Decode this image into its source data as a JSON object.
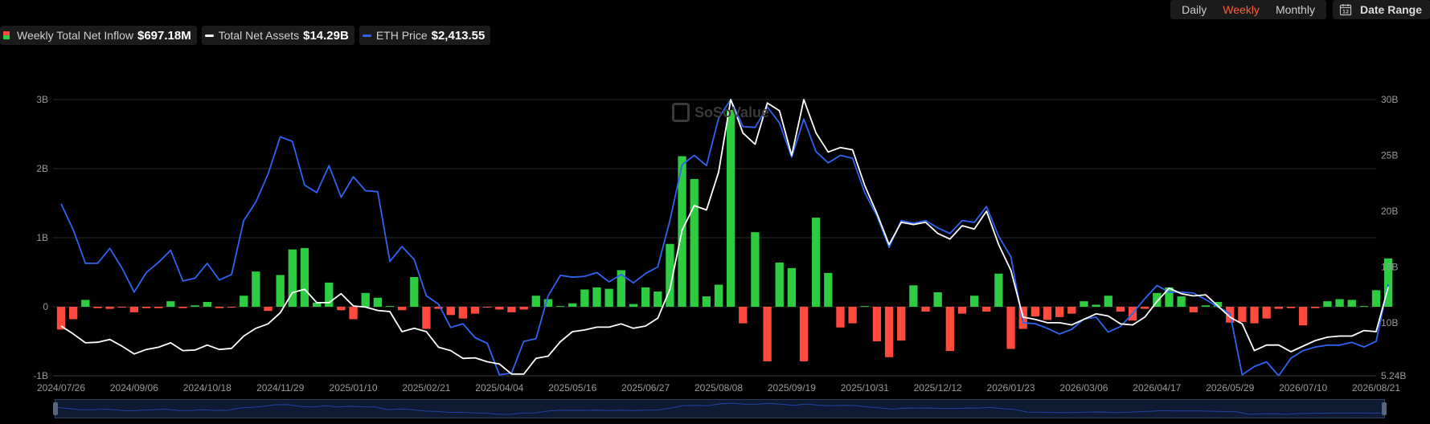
{
  "controls": {
    "periods": [
      "Daily",
      "Weekly",
      "Monthly"
    ],
    "active_period": "Weekly",
    "date_range_label": "Date Range"
  },
  "legend": {
    "inflow_label": "Weekly Total Net Inflow",
    "inflow_value": "$697.18M",
    "assets_label": "Total Net Assets",
    "assets_value": "$14.29B",
    "price_label": "ETH Price",
    "price_value": "$2,413.55"
  },
  "watermark": "SoSoValue",
  "colors": {
    "positive": "#2ecc40",
    "negative": "#ff4a3d",
    "assets_line": "#ffffff",
    "price_line": "#2f63f0",
    "active_period": "#ff5b3a"
  },
  "chart_data": {
    "type": "bar",
    "x": [
      "2024/07/26",
      "2024/08/02",
      "2024/08/09",
      "2024/08/16",
      "2024/08/23",
      "2024/08/30",
      "2024/09/06",
      "2024/09/13",
      "2024/09/20",
      "2024/09/27",
      "2024/10/04",
      "2024/10/11",
      "2024/10/18",
      "2024/10/25",
      "2024/11/01",
      "2024/11/08",
      "2024/11/15",
      "2024/11/22",
      "2024/11/29",
      "2024/12/06",
      "2024/12/13",
      "2024/12/20",
      "2024/12/27",
      "2025/01/03",
      "2025/01/10",
      "2025/01/17",
      "2025/01/24",
      "2025/01/31",
      "2025/02/07",
      "2025/02/14",
      "2025/02/21",
      "2025/02/28",
      "2025/03/07",
      "2025/03/14",
      "2025/03/21",
      "2025/03/28",
      "2025/04/04",
      "2025/04/11",
      "2025/04/18",
      "2025/04/25",
      "2025/05/02",
      "2025/05/09",
      "2025/05/16",
      "2025/05/23",
      "2025/05/30",
      "2025/06/06",
      "2025/06/13",
      "2025/06/20",
      "2025/06/27",
      "2025/07/04",
      "2025/07/11",
      "2025/07/18",
      "2025/07/25",
      "2025/08/01",
      "2025/08/08",
      "2025/08/15",
      "2025/08/22",
      "2025/08/29",
      "2025/09/05",
      "2025/09/12",
      "2025/09/19",
      "2025/09/26",
      "2025/10/03",
      "2025/10/10",
      "2025/10/17",
      "2025/10/24",
      "2025/10/31",
      "2025/11/07",
      "2025/11/14",
      "2025/11/21",
      "2025/11/28",
      "2025/12/05",
      "2025/12/12",
      "2025/12/19",
      "2025/12/26",
      "2026/01/02",
      "2026/01/09",
      "2026/01/16",
      "2026/01/23",
      "2026/01/30",
      "2026/02/06",
      "2026/02/13",
      "2026/02/20",
      "2026/02/27",
      "2026/03/06",
      "2026/03/13",
      "2026/03/20",
      "2026/03/27",
      "2026/04/03",
      "2026/04/10",
      "2026/04/17",
      "2026/04/24",
      "2026/05/01",
      "2026/05/08",
      "2026/05/15",
      "2026/05/22",
      "2026/05/29",
      "2026/06/05",
      "2026/06/12",
      "2026/06/19",
      "2026/06/26",
      "2026/07/03",
      "2026/07/10",
      "2026/07/17",
      "2026/07/24",
      "2026/07/31",
      "2026/08/07",
      "2026/08/14",
      "2026/08/21"
    ],
    "x_tick_labels": [
      "2024/07/26",
      "2024/09/06",
      "2024/10/18",
      "2024/11/29",
      "2025/01/10",
      "2025/02/21",
      "2025/04/04",
      "2025/05/16",
      "2025/06/27",
      "2025/08/08",
      "2025/09/19",
      "2025/10/31",
      "2025/12/12",
      "2026/01/23",
      "2026/03/06",
      "2026/04/17",
      "2026/05/29",
      "2026/07/10",
      "2026/08/21"
    ],
    "series": [
      {
        "name": "Weekly Total Net Inflow",
        "unit": "B",
        "axis": "left",
        "values": [
          -0.33,
          -0.18,
          0.1,
          -0.02,
          -0.03,
          -0.01,
          -0.08,
          -0.02,
          -0.02,
          0.08,
          -0.02,
          0.02,
          0.07,
          -0.02,
          -0.01,
          0.16,
          0.51,
          -0.06,
          0.46,
          0.83,
          0.85,
          0.06,
          0.35,
          -0.05,
          -0.18,
          0.2,
          0.13,
          0.01,
          -0.05,
          0.43,
          -0.32,
          -0.03,
          -0.12,
          -0.17,
          -0.1,
          -0.01,
          -0.04,
          -0.08,
          -0.04,
          0.16,
          0.11,
          0.01,
          0.05,
          0.25,
          0.28,
          0.26,
          0.53,
          0.04,
          0.28,
          0.22,
          0.91,
          2.18,
          1.85,
          0.15,
          0.32,
          2.85,
          -0.24,
          1.08,
          -0.79,
          0.64,
          0.56,
          -0.79,
          1.29,
          0.49,
          -0.3,
          -0.24,
          0.01,
          -0.5,
          -0.73,
          -0.49,
          0.31,
          -0.07,
          0.21,
          -0.64,
          -0.1,
          0.16,
          -0.07,
          0.48,
          -0.61,
          -0.32,
          -0.14,
          -0.19,
          -0.15,
          -0.1,
          0.08,
          0.03,
          0.16,
          -0.07,
          -0.2,
          -0.03,
          0.2,
          0.28,
          0.15,
          -0.08,
          0.02,
          0.07,
          -0.23,
          -0.22,
          -0.24,
          -0.17,
          -0.03,
          -0.02,
          -0.27,
          -0.02,
          0.08,
          0.11,
          0.1,
          0.01,
          0.24,
          0.7
        ]
      },
      {
        "name": "Total Net Assets",
        "unit": "B",
        "axis": "right",
        "values": [
          9.7,
          9.0,
          8.2,
          8.25,
          8.5,
          7.9,
          7.2,
          7.6,
          7.8,
          8.2,
          7.5,
          7.55,
          8.0,
          7.6,
          7.7,
          8.8,
          9.5,
          9.9,
          10.9,
          12.7,
          13.0,
          11.8,
          11.8,
          12.6,
          11.5,
          11.4,
          11.1,
          11.0,
          9.2,
          9.5,
          9.2,
          7.8,
          7.5,
          6.8,
          6.85,
          6.5,
          6.3,
          5.4,
          5.4,
          6.8,
          7.0,
          8.3,
          9.2,
          9.35,
          9.6,
          9.6,
          9.9,
          9.5,
          9.7,
          10.4,
          13.0,
          18.3,
          20.5,
          20.1,
          23.5,
          30.0,
          27.0,
          26.0,
          29.7,
          29.0,
          25.0,
          30.0,
          27.0,
          25.3,
          25.7,
          25.5,
          22.3,
          19.8,
          17.0,
          19.0,
          18.8,
          19.0,
          18.0,
          17.5,
          18.7,
          18.4,
          20.0,
          17.0,
          14.7,
          10.5,
          10.3,
          10.0,
          10.0,
          9.8,
          10.3,
          10.8,
          10.6,
          9.9,
          9.8,
          10.5,
          11.9,
          13.1,
          12.6,
          12.4,
          12.5,
          11.5,
          10.5,
          9.9,
          7.5,
          8.0,
          8.0,
          7.4,
          7.9,
          8.4,
          8.7,
          8.8,
          8.8,
          9.3,
          9.2,
          13.2
        ]
      },
      {
        "name": "ETH Price",
        "unit": "USD",
        "axis": "price",
        "values": [
          3280,
          3000,
          2640,
          2640,
          2800,
          2590,
          2330,
          2540,
          2650,
          2780,
          2450,
          2480,
          2640,
          2460,
          2520,
          3100,
          3300,
          3600,
          4000,
          3950,
          3480,
          3400,
          3690,
          3350,
          3570,
          3420,
          3410,
          2660,
          2820,
          2680,
          2290,
          2200,
          1950,
          1990,
          1840,
          1780,
          1440,
          1460,
          1800,
          1830,
          2290,
          2510,
          2490,
          2500,
          2540,
          2440,
          2520,
          2430,
          2530,
          2600,
          3100,
          3700,
          3800,
          3690,
          4200,
          4400,
          4110,
          4100,
          4320,
          4150,
          3780,
          4190,
          3840,
          3720,
          3800,
          3770,
          3400,
          3150,
          2810,
          3100,
          3070,
          3100,
          3020,
          2960,
          3100,
          3080,
          3250,
          2930,
          2710,
          2000,
          1990,
          1940,
          1880,
          1930,
          2040,
          2060,
          1900,
          1960,
          2100,
          2260,
          2400,
          2330,
          2330,
          2320,
          2250,
          2170,
          2100,
          1440,
          1530,
          1580,
          1430,
          1620,
          1700,
          1740,
          1760,
          1760,
          1790,
          1740,
          1800,
          2413.55
        ]
      }
    ],
    "y_left_ticks": [
      "3B",
      "2B",
      "1B",
      "0",
      "-1B"
    ],
    "y_right_ticks": [
      "30B",
      "25B",
      "20B",
      "15B",
      "10B",
      "5.24B"
    ],
    "ylim_left": [
      -1,
      3
    ],
    "ylim_right": [
      5.24,
      30
    ],
    "ylim_price": [
      1430,
      4400
    ],
    "grid": "horizontal",
    "legend_position": "top-left"
  }
}
